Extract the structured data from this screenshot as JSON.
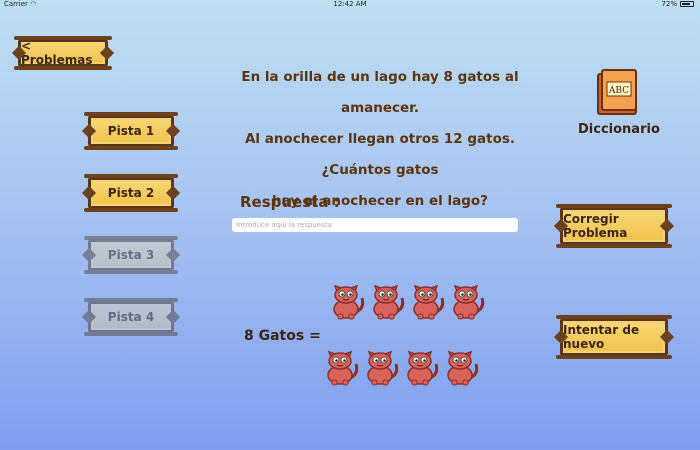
{
  "status_bar": {
    "carrier": "Carrier",
    "time": "12:42 AM",
    "battery": "72%"
  },
  "nav": {
    "back_label": "< Problemas"
  },
  "problem": {
    "lines": [
      "En la orilla de un lago hay 8 gatos al amanecer.",
      "Al anochecer llegan otros 12 gatos. ¿Cuántos gatos",
      "hay al anochecer en el lago?"
    ]
  },
  "dictionary": {
    "label": "Diccionario",
    "book_text": "ABC"
  },
  "hints": [
    {
      "label": "Pista 1",
      "enabled": true
    },
    {
      "label": "Pista 2",
      "enabled": true
    },
    {
      "label": "Pista 3",
      "enabled": false
    },
    {
      "label": "Pista 4",
      "enabled": false
    }
  ],
  "answer": {
    "label": "Respuesta :",
    "value": "",
    "placeholder": "Introduce aquí la respuesta"
  },
  "illustration": {
    "label": "8 Gatos =",
    "cat_count": 8
  },
  "actions": {
    "check_label": "Corregir Problema",
    "retry_label": "Intentar de nuevo"
  },
  "colors": {
    "sign": "#f0c24b",
    "wood": "#5b3616",
    "text_brown": "#5b3410",
    "cat": "#d9625a"
  }
}
